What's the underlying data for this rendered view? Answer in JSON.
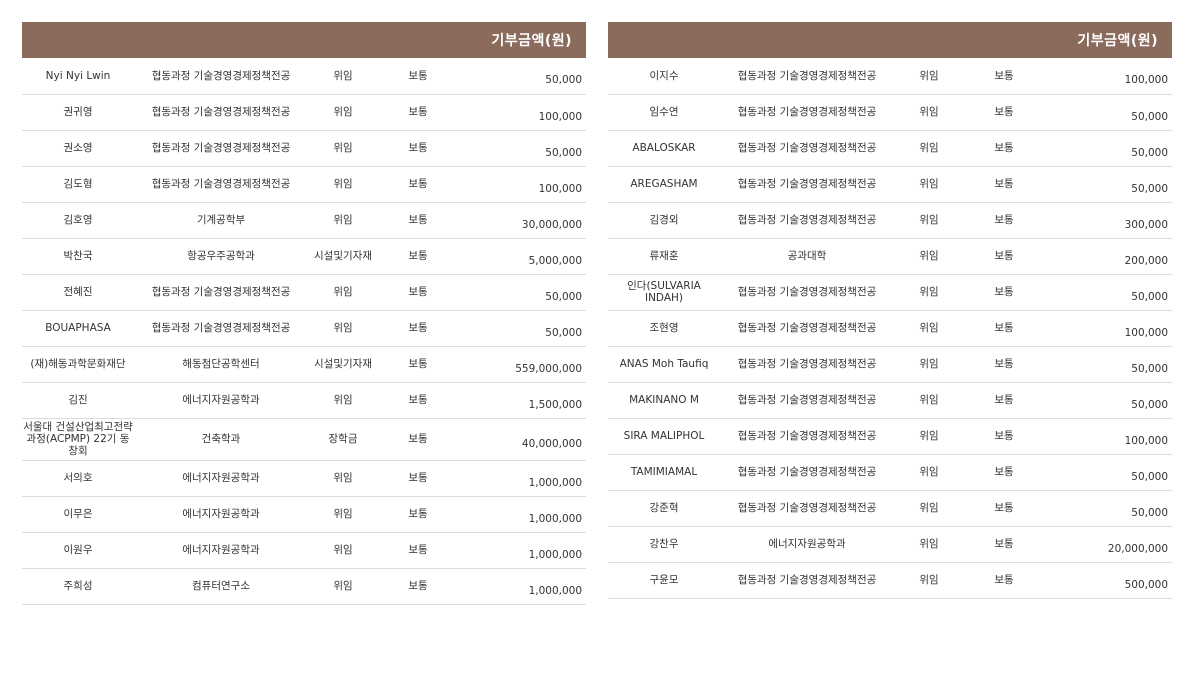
{
  "header_label": "기부금액(원)",
  "left_rows": [
    {
      "name": "Nyi Nyi Lwin",
      "dept": "협동과정 기술경영경제정책전공",
      "purpose": "위임",
      "type": "보통",
      "amount": "50,000"
    },
    {
      "name": "권귀영",
      "dept": "협동과정 기술경영경제정책전공",
      "purpose": "위임",
      "type": "보통",
      "amount": "100,000"
    },
    {
      "name": "권소영",
      "dept": "협동과정 기술경영경제정책전공",
      "purpose": "위임",
      "type": "보통",
      "amount": "50,000"
    },
    {
      "name": "김도형",
      "dept": "협동과정 기술경영경제정책전공",
      "purpose": "위임",
      "type": "보통",
      "amount": "100,000"
    },
    {
      "name": "김호영",
      "dept": "기계공학부",
      "purpose": "위임",
      "type": "보통",
      "amount": "30,000,000"
    },
    {
      "name": "박찬국",
      "dept": "항공우주공학과",
      "purpose": "시설및기자재",
      "type": "보통",
      "amount": "5,000,000"
    },
    {
      "name": "전혜진",
      "dept": "협동과정 기술경영경제정책전공",
      "purpose": "위임",
      "type": "보통",
      "amount": "50,000"
    },
    {
      "name": "BOUAPHASA",
      "dept": "협동과정 기술경영경제정책전공",
      "purpose": "위임",
      "type": "보통",
      "amount": "50,000"
    },
    {
      "name": "(재)해동과학문화재단",
      "dept": "해동첨단공학센터",
      "purpose": "시설및기자재",
      "type": "보통",
      "amount": "559,000,000"
    },
    {
      "name": "김진",
      "dept": "에너지자원공학과",
      "purpose": "위임",
      "type": "보통",
      "amount": "1,500,000"
    },
    {
      "name": "서울대 건설산업최고전략과정(ACPMP) 22기 동창회",
      "dept": "건축학과",
      "purpose": "장학금",
      "type": "보통",
      "amount": "40,000,000"
    },
    {
      "name": "서의호",
      "dept": "에너지자원공학과",
      "purpose": "위임",
      "type": "보통",
      "amount": "1,000,000"
    },
    {
      "name": "이무은",
      "dept": "에너지자원공학과",
      "purpose": "위임",
      "type": "보통",
      "amount": "1,000,000"
    },
    {
      "name": "이원우",
      "dept": "에너지자원공학과",
      "purpose": "위임",
      "type": "보통",
      "amount": "1,000,000"
    },
    {
      "name": "주희성",
      "dept": "컴퓨터연구소",
      "purpose": "위임",
      "type": "보통",
      "amount": "1,000,000"
    }
  ],
  "right_rows": [
    {
      "name": "이지수",
      "dept": "협동과정 기술경영경제정책전공",
      "purpose": "위임",
      "type": "보통",
      "amount": "100,000"
    },
    {
      "name": "임수연",
      "dept": "협동과정 기술경영경제정책전공",
      "purpose": "위임",
      "type": "보통",
      "amount": "50,000"
    },
    {
      "name": "ABALOSKAR",
      "dept": "협동과정 기술경영경제정책전공",
      "purpose": "위임",
      "type": "보통",
      "amount": "50,000"
    },
    {
      "name": "AREGASHAM",
      "dept": "협동과정 기술경영경제정책전공",
      "purpose": "위임",
      "type": "보통",
      "amount": "50,000"
    },
    {
      "name": "김경외",
      "dept": "협동과정 기술경영경제정책전공",
      "purpose": "위임",
      "type": "보통",
      "amount": "300,000"
    },
    {
      "name": "류재훈",
      "dept": "공과대학",
      "purpose": "위임",
      "type": "보통",
      "amount": "200,000"
    },
    {
      "name": "인다(SULVARIA INDAH)",
      "dept": "협동과정 기술경영경제정책전공",
      "purpose": "위임",
      "type": "보통",
      "amount": "50,000"
    },
    {
      "name": "조현영",
      "dept": "협동과정 기술경영경제정책전공",
      "purpose": "위임",
      "type": "보통",
      "amount": "100,000"
    },
    {
      "name": "ANAS Moh Taufiq",
      "dept": "협동과정 기술경영경제정책전공",
      "purpose": "위임",
      "type": "보통",
      "amount": "50,000"
    },
    {
      "name": "MAKINANO M",
      "dept": "협동과정 기술경영경제정책전공",
      "purpose": "위임",
      "type": "보통",
      "amount": "50,000"
    },
    {
      "name": "SIRA MALIPHOL",
      "dept": "협동과정 기술경영경제정책전공",
      "purpose": "위임",
      "type": "보통",
      "amount": "100,000"
    },
    {
      "name": "TAMIMIAMAL",
      "dept": "협동과정 기술경영경제정책전공",
      "purpose": "위임",
      "type": "보통",
      "amount": "50,000"
    },
    {
      "name": "강준혁",
      "dept": "협동과정 기술경영경제정책전공",
      "purpose": "위임",
      "type": "보통",
      "amount": "50,000"
    },
    {
      "name": "강찬우",
      "dept": "에너지자원공학과",
      "purpose": "위임",
      "type": "보통",
      "amount": "20,000,000"
    },
    {
      "name": "구윤모",
      "dept": "협동과정 기술경영경제정책전공",
      "purpose": "위임",
      "type": "보통",
      "amount": "500,000"
    }
  ]
}
